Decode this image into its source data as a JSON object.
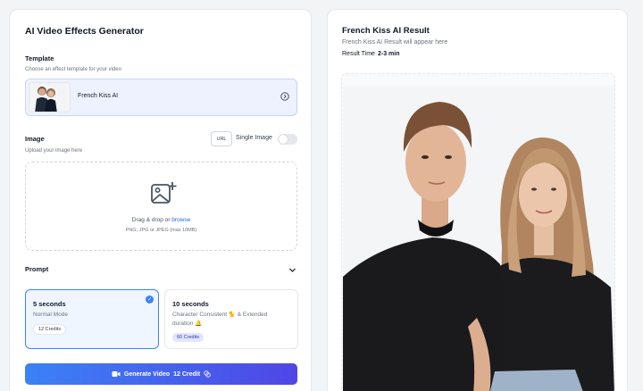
{
  "generator": {
    "title": "AI Video Effects Generator",
    "template": {
      "label": "Template",
      "hint": "Choose an effect template for your video",
      "selected": "French Kiss AI"
    },
    "image": {
      "label": "Image",
      "hint": "Upload your image here",
      "url_button": "URL",
      "single_image_label": "Single Image",
      "single_image_on": false,
      "drop_text_prefix": "Drag & drop or ",
      "drop_text_link": "browse",
      "drop_hint": "PNG, JPG or JPEG (max 10MB)"
    },
    "prompt": {
      "label": "Prompt"
    },
    "modes": [
      {
        "title": "5 seconds",
        "desc": "Normal Mode",
        "credits": "12 Credits",
        "selected": true
      },
      {
        "title": "10 seconds",
        "desc": "Character Consistent 🐈 & Extended duration 🔔",
        "credits": "60 Credits",
        "selected": false
      }
    ],
    "generate_button": {
      "label": "Generate Video",
      "credit": "12 Credit"
    }
  },
  "result": {
    "title": "French Kiss AI Result",
    "subtitle": "French Kiss AI Result will appear here",
    "time_label": "Result Time",
    "time_value": "2-3 min"
  },
  "colors": {
    "accent": "#3b82f6",
    "button_gradient_end": "#4f46e5",
    "selected_bg": "#eff6ff"
  },
  "icons": {
    "template_go": "circle-arrow-right-icon",
    "upload": "image-plus-icon",
    "prompt_toggle": "chevron-down-icon",
    "mode_selected": "check-icon",
    "generate": "video-icon",
    "credit": "coins-icon"
  }
}
